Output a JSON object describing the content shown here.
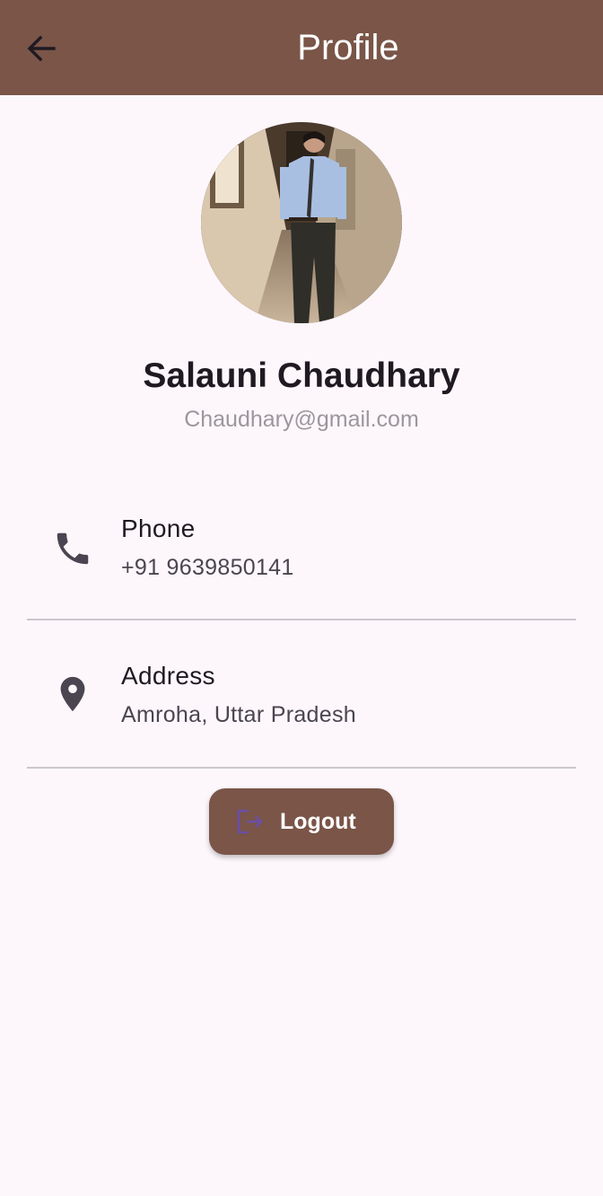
{
  "appbar": {
    "title": "Profile",
    "back_icon": "arrow-left-icon",
    "background": "#7a5548"
  },
  "profile": {
    "avatar_icon": "profile-photo",
    "name": "Salauni Chaudhary",
    "email": "Chaudhary@gmail.com"
  },
  "details": [
    {
      "icon": "phone-icon",
      "title": "Phone",
      "value": "+91 9639850141"
    },
    {
      "icon": "location-pin-icon",
      "title": "Address",
      "value": "Amroha, Uttar Pradesh"
    }
  ],
  "logout": {
    "label": "Logout",
    "icon": "logout-icon",
    "background": "#7a5548"
  }
}
